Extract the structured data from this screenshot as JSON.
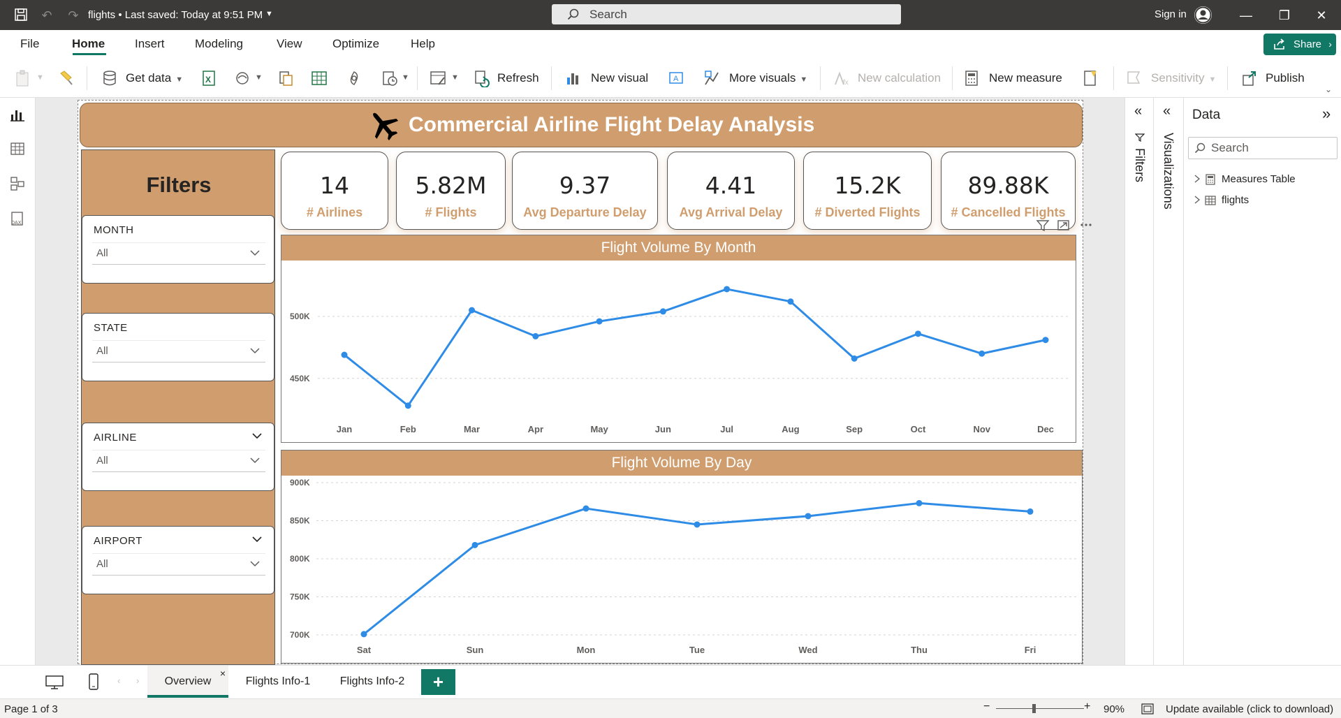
{
  "titlebar": {
    "file_title": "flights • Last saved: Today at 9:51 PM",
    "search_placeholder": "Search",
    "sign_in": "Sign in"
  },
  "menu": {
    "items": [
      "File",
      "Home",
      "Insert",
      "Modeling",
      "View",
      "Optimize",
      "Help"
    ],
    "active": "Home",
    "share": "Share"
  },
  "ribbon": {
    "get_data": "Get data",
    "refresh": "Refresh",
    "new_visual": "New visual",
    "more_visuals": "More visuals",
    "new_calculation": "New calculation",
    "new_measure": "New measure",
    "sensitivity": "Sensitivity",
    "publish": "Publish"
  },
  "report": {
    "title": "Commercial Airline Flight Delay Analysis",
    "filters_title": "Filters",
    "slicers": [
      {
        "label": "MONTH",
        "value": "All"
      },
      {
        "label": "STATE",
        "value": "All"
      },
      {
        "label": "AIRLINE",
        "value": "All"
      },
      {
        "label": "AIRPORT",
        "value": "All"
      }
    ],
    "kpis": [
      {
        "value": "14",
        "label": "# Airlines"
      },
      {
        "value": "5.82M",
        "label": "# Flights"
      },
      {
        "value": "9.37",
        "label": "Avg Departure Delay"
      },
      {
        "value": "4.41",
        "label": "Avg Arrival Delay"
      },
      {
        "value": "15.2K",
        "label": "# Diverted Flights"
      },
      {
        "value": "89.88K",
        "label": "# Cancelled Flights"
      }
    ]
  },
  "chart_data": [
    {
      "type": "line",
      "title": "Flight Volume By Month",
      "categories": [
        "Jan",
        "Feb",
        "Mar",
        "Apr",
        "May",
        "Jun",
        "Jul",
        "Aug",
        "Sep",
        "Oct",
        "Nov",
        "Dec"
      ],
      "values": [
        469000,
        428000,
        505000,
        484000,
        496000,
        504000,
        522000,
        512000,
        466000,
        486000,
        470000,
        481000
      ],
      "yticks": [
        "450K",
        "500K"
      ],
      "ytick_values": [
        450000,
        500000
      ],
      "ylim": [
        420000,
        540000
      ],
      "color": "#2e8ce6",
      "grid": true
    },
    {
      "type": "line",
      "title": "Flight Volume By Day",
      "categories": [
        "Sat",
        "Sun",
        "Mon",
        "Tue",
        "Wed",
        "Thu",
        "Fri"
      ],
      "values": [
        701000,
        818000,
        866000,
        845000,
        856000,
        873000,
        862000
      ],
      "yticks": [
        "700K",
        "750K",
        "800K",
        "850K",
        "900K"
      ],
      "ytick_values": [
        700000,
        750000,
        800000,
        850000,
        900000
      ],
      "ylim": [
        700000,
        900000
      ],
      "color": "#2e8ce6",
      "grid": true
    }
  ],
  "panes": {
    "filters": "Filters",
    "visualizations": "Visualizations",
    "data": {
      "title": "Data",
      "search_placeholder": "Search",
      "tables": [
        "Measures Table",
        "flights"
      ]
    }
  },
  "pages": {
    "tabs": [
      "Overview",
      "Flights Info-1",
      "Flights Info-2"
    ],
    "active": "Overview",
    "add": "+"
  },
  "status": {
    "page": "Page 1 of 3",
    "zoom": "90%",
    "update": "Update available (click to download)"
  },
  "colors": {
    "accent": "#117865",
    "tan": "#d09e6e",
    "line": "#2e8ce6",
    "titlebar": "#3b3a39"
  }
}
